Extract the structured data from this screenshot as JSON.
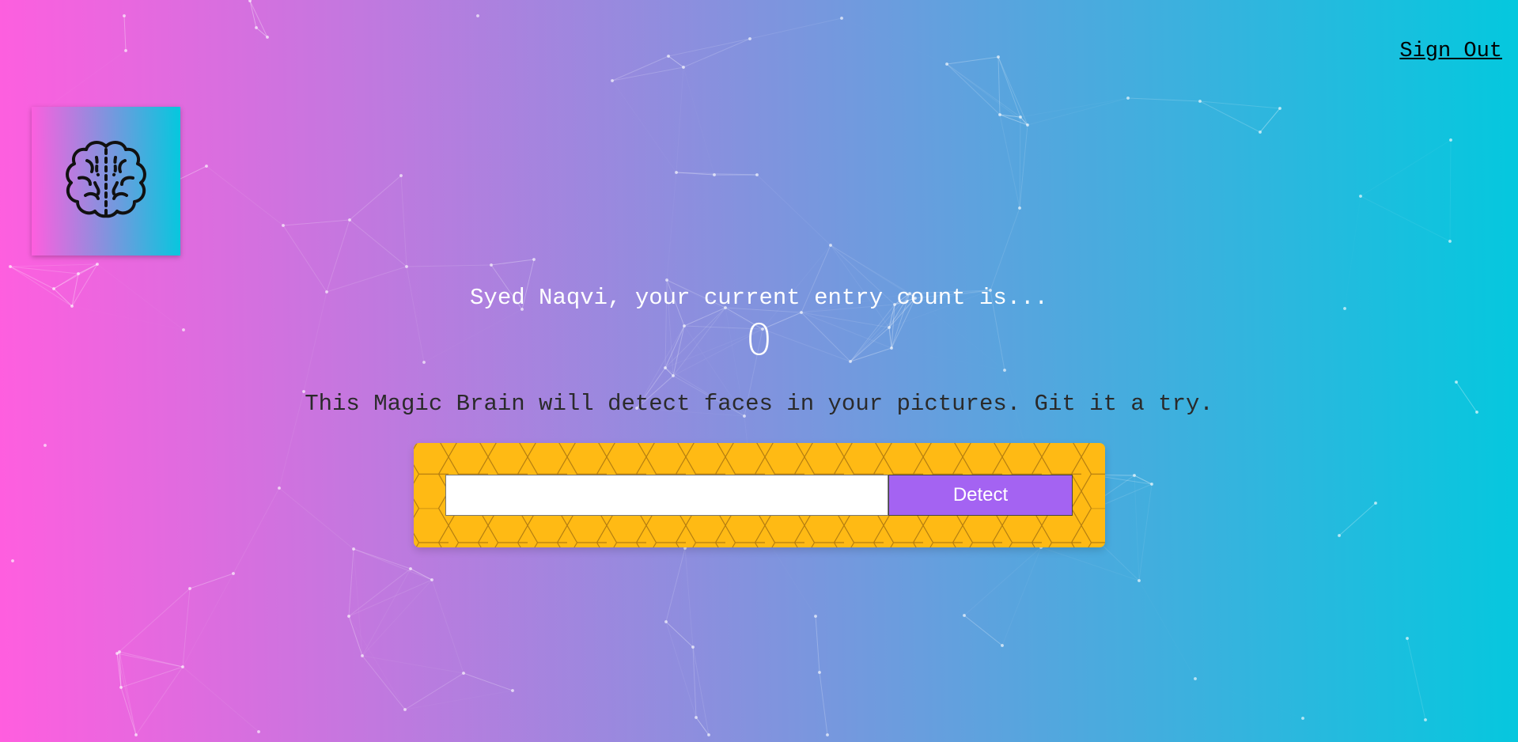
{
  "header": {
    "sign_out_label": "Sign Out"
  },
  "logo": {
    "icon": "brain-icon"
  },
  "rank": {
    "message": "Syed Naqvi, your current entry count is...",
    "count": "0"
  },
  "intro": {
    "text": "This Magic Brain will detect faces in your pictures. Git it a try."
  },
  "form": {
    "input_value": "",
    "input_placeholder": "",
    "detect_label": "Detect"
  },
  "colors": {
    "gradient_start": "#ff5edf",
    "gradient_end": "#04c8de",
    "panel": "#ffba14",
    "button": "#a463f2"
  }
}
